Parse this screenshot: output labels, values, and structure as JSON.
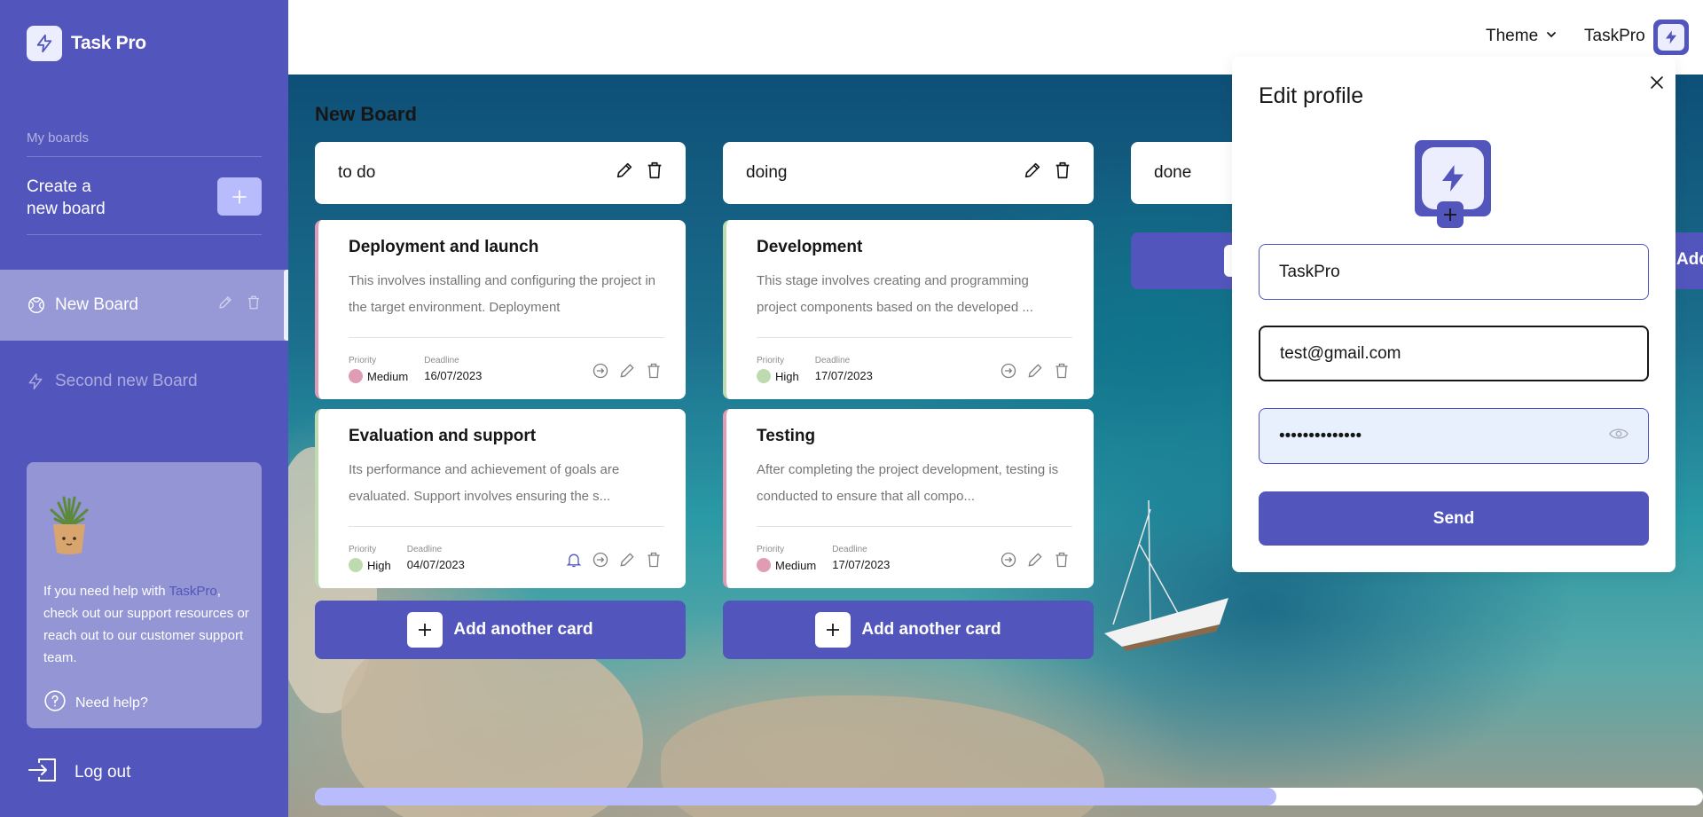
{
  "app": {
    "name": "Task Pro"
  },
  "sidebar": {
    "section_label": "My boards",
    "create_line1": "Create a",
    "create_line2": "new board",
    "boards": [
      {
        "label": "New Board",
        "active": true
      },
      {
        "label": "Second new Board",
        "active": false
      }
    ],
    "help": {
      "text_before": "If you need help with ",
      "brand": "TaskPro",
      "text_after": ", check out our support resources or reach out to our customer support team.",
      "need_help": "Need help?"
    },
    "logout": "Log out"
  },
  "header": {
    "theme_label": "Theme",
    "user_name": "TaskPro"
  },
  "board": {
    "title": "New Board",
    "columns": [
      {
        "title": "to do",
        "cards": [
          {
            "title": "Deployment and launch",
            "description": "This involves installing and configuring the project in the target environment. Deployment",
            "priority_label": "Priority",
            "priority": "Medium",
            "priority_color": "#E09CB5",
            "deadline_label": "Deadline",
            "deadline": "16/07/2023"
          },
          {
            "title": "Evaluation and support",
            "description": "Its performance and achievement of goals are evaluated. Support involves ensuring the s...",
            "priority_label": "Priority",
            "priority": "High",
            "priority_color": "#BEDBB0",
            "deadline_label": "Deadline",
            "deadline": "04/07/2023"
          }
        ],
        "add_label": "Add another card"
      },
      {
        "title": "doing",
        "cards": [
          {
            "title": "Development",
            "description": "This stage involves creating and programming project components based on the developed ...",
            "priority_label": "Priority",
            "priority": "High",
            "priority_color": "#BEDBB0",
            "deadline_label": "Deadline",
            "deadline": "17/07/2023"
          },
          {
            "title": "Testing",
            "description": "After completing the project development, testing is conducted to ensure that all compo...",
            "priority_label": "Priority",
            "priority": "Medium",
            "priority_color": "#E09CB5",
            "deadline_label": "Deadline",
            "deadline": "17/07/2023"
          }
        ],
        "add_label": "Add another card"
      },
      {
        "title": "done",
        "add_label_partial": "Add"
      }
    ]
  },
  "modal": {
    "title": "Edit profile",
    "name_value": "TaskPro",
    "email_value": "test@gmail.com",
    "password_mask": "••••••••••••••",
    "send_label": "Send"
  },
  "colors": {
    "accent": "#5255BC",
    "accent_light": "#B8BCFD",
    "priority_medium": "#E09CB5",
    "priority_high": "#BEDBB0"
  }
}
